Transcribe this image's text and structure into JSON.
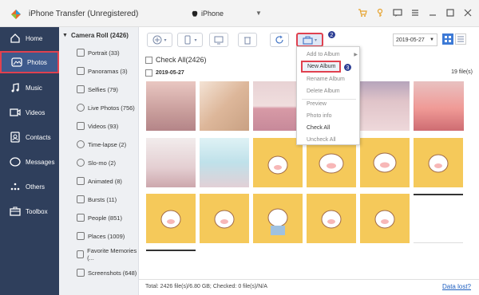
{
  "app": {
    "title": "iPhone Transfer (Unregistered)",
    "device": "iPhone"
  },
  "sidebar": {
    "items": [
      {
        "label": "Home",
        "icon": "home-icon"
      },
      {
        "label": "Photos",
        "icon": "photos-icon",
        "badge": "1"
      },
      {
        "label": "Music",
        "icon": "music-icon"
      },
      {
        "label": "Videos",
        "icon": "videos-icon"
      },
      {
        "label": "Contacts",
        "icon": "contacts-icon"
      },
      {
        "label": "Messages",
        "icon": "messages-icon"
      },
      {
        "label": "Others",
        "icon": "others-icon"
      },
      {
        "label": "Toolbox",
        "icon": "toolbox-icon"
      }
    ]
  },
  "albums": {
    "header": "Camera Roll (2426)",
    "items": [
      "Portrait (33)",
      "Panoramas (3)",
      "Selfies (79)",
      "Live Photos (756)",
      "Videos (93)",
      "Time-lapse (2)",
      "Slo-mo (2)",
      "Animated (8)",
      "Bursts (11)",
      "People (851)",
      "Places (1009)",
      "Favorite Memories (...",
      "Screenshots (648)"
    ]
  },
  "toolbar": {
    "date": "2019-05-27",
    "badge": "2"
  },
  "content": {
    "check_all": "Check All(2426)",
    "date_group": "2019-05-27",
    "file_count": "19 file(s)"
  },
  "dropdown": {
    "badge": "3",
    "items": [
      "Add to Album",
      "New Album",
      "Rename Album",
      "Delete Album",
      "Preview",
      "Photo info",
      "Check All",
      "Uncheck All"
    ]
  },
  "footer": {
    "total": "Total: 2426 file(s)/6.80 GB; Checked: 0 file(s)/N/A",
    "data_lost": "Data lost?"
  },
  "colors": {
    "sidebar": "#2f3f5c",
    "highlight": "#e0414f",
    "accent": "#2c3e94",
    "link": "#2060c0"
  }
}
